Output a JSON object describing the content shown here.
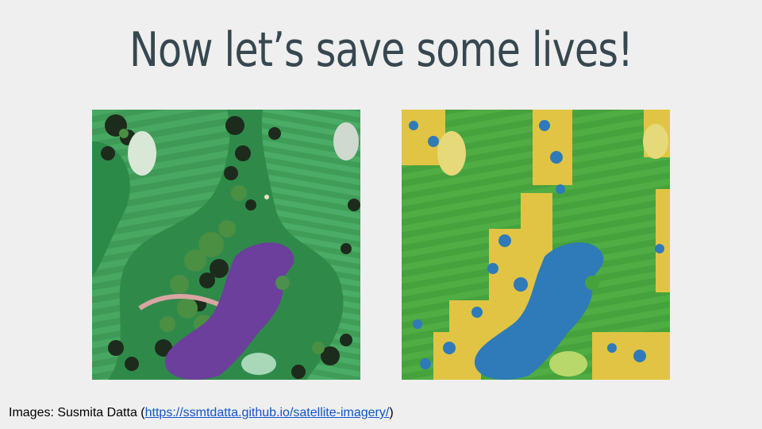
{
  "slide": {
    "title": "Now let’s save some lives!",
    "caption_prefix": "Images: Susmita Datta (",
    "caption_link": "https://ssmtdatta.github.io/satellite-imagery/",
    "caption_suffix": ")"
  },
  "colors": {
    "background": "#efefef",
    "title": "#37474f",
    "link": "#1155cc",
    "fairway": "#3f9a55",
    "water_original": "#6a3f9a",
    "seg_grass": "#4ba63f",
    "seg_trees": "#e7c94a",
    "seg_water": "#2f79b8"
  }
}
